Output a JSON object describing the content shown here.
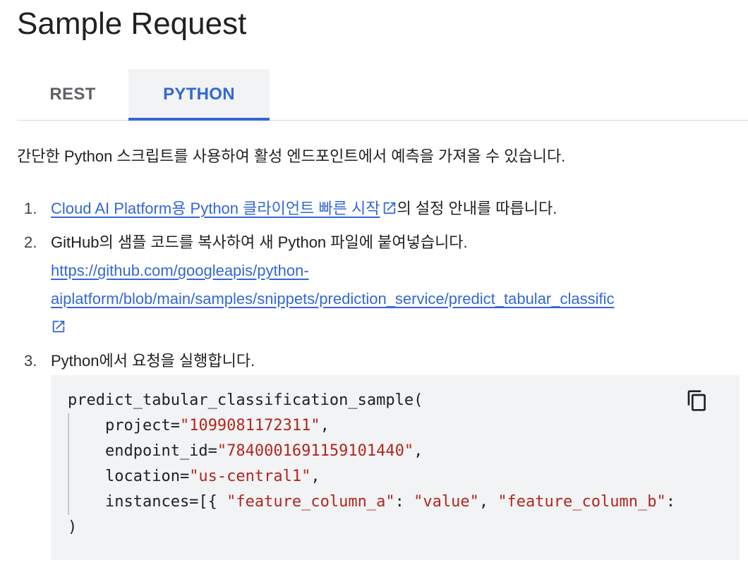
{
  "page_title": "Sample Request",
  "tabs": [
    {
      "label": "REST",
      "selected": false
    },
    {
      "label": "PYTHON",
      "selected": true
    }
  ],
  "intro": "간단한 Python 스크립트를 사용하여 활성 엔드포인트에서 예측을 가져올 수 있습니다.",
  "steps": [
    {
      "number": "1.",
      "link_text": "Cloud AI Platform용 Python 클라이언트 빠른 시작",
      "suffix": "의 설정 안내를 따릅니다."
    },
    {
      "number": "2.",
      "text": "GitHub의 샘플 코드를 복사하여 새 Python 파일에 붙여넣습니다.",
      "url_line1": "https://github.com/googleapis/python-",
      "url_line2": "aiplatform/blob/main/samples/snippets/prediction_service/predict_tabular_classific"
    },
    {
      "number": "3.",
      "text": "Python에서 요청을 실행합니다."
    }
  ],
  "code": {
    "func_call": "predict_tabular_classification_sample(",
    "project_key": "    project=",
    "project_val": "\"1099081172311\"",
    "endpoint_key": "    endpoint_id=",
    "endpoint_val": "\"7840001691159101440\"",
    "location_key": "    location=",
    "location_val": "\"us-central1\"",
    "instances_key": "    instances=[{ ",
    "feature_a": "\"feature_column_a\"",
    "colon1": ": ",
    "value": "\"value\"",
    "comma": ", ",
    "feature_b": "\"feature_column_b\"",
    "colon2": ":",
    "close": ")",
    "sep": ","
  },
  "colors": {
    "link": "#3367d6",
    "tab_active": "#3367d6",
    "string": "#b3261e",
    "code_bg": "#f1f3f4"
  },
  "icons": {
    "external_link": "external-link-icon",
    "copy": "copy-icon"
  }
}
